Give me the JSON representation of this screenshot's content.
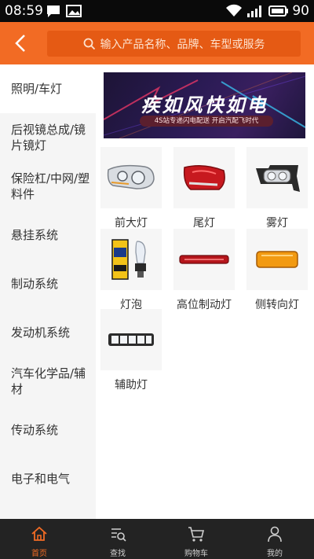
{
  "status_bar": {
    "time": "08:59",
    "battery": "90"
  },
  "search": {
    "placeholder": "输入产品名称、品牌、车型或服务"
  },
  "sidebar": {
    "items": [
      {
        "label": "照明/车灯",
        "active": true
      },
      {
        "label": "后视镜总成/镜片镜灯"
      },
      {
        "label": "保险杠/中网/塑料件"
      },
      {
        "label": "悬挂系统"
      },
      {
        "label": "制动系统"
      },
      {
        "label": "发动机系统"
      },
      {
        "label": "汽车化学品/辅材"
      },
      {
        "label": "传动系统"
      },
      {
        "label": "电子和电气"
      }
    ]
  },
  "banner": {
    "title": "疾如风快如电",
    "subtitle": "4S站专递闪电配送  开启汽配飞时代"
  },
  "products": [
    {
      "label": "前大灯",
      "icon": "headlight-icon"
    },
    {
      "label": "尾灯",
      "icon": "taillight-icon"
    },
    {
      "label": "雾灯",
      "icon": "fog-light-icon"
    },
    {
      "label": "灯泡",
      "icon": "bulb-icon"
    },
    {
      "label": "高位制动灯",
      "icon": "brake-light-icon"
    },
    {
      "label": "侧转向灯",
      "icon": "side-turn-signal-icon"
    },
    {
      "label": "辅助灯",
      "icon": "auxiliary-light-icon"
    }
  ],
  "bottom_nav": {
    "items": [
      {
        "label": "首页",
        "icon": "home-icon",
        "active": true
      },
      {
        "label": "查找",
        "icon": "find-icon"
      },
      {
        "label": "购物车",
        "icon": "cart-icon"
      },
      {
        "label": "我的",
        "icon": "user-icon"
      }
    ]
  },
  "colors": {
    "accent": "#f26b24",
    "header": "#f26b24",
    "nav_bg": "#232323"
  }
}
